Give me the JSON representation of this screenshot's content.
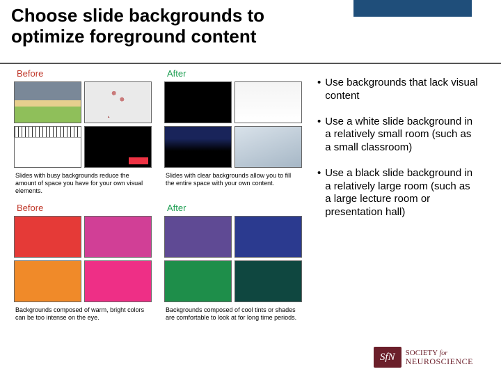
{
  "header": {
    "title": "Choose slide backgrounds to optimize foreground content"
  },
  "labels": {
    "before": "Before",
    "after": "After"
  },
  "captions": {
    "busy": "Slides with busy backgrounds reduce the amount of space you have for your own visual elements.",
    "clear": "Slides with clear backgrounds allow you to fill the entire space with your own content.",
    "warm": "Backgrounds composed of warm, bright colors can be too intense on the eye.",
    "cool": "Backgrounds composed of cool tints or shades are comfortable to look at for long time periods."
  },
  "bullets": {
    "b1": "Use backgrounds that lack visual content",
    "b2": "Use a white slide background in a relatively small room (such as a small classroom)",
    "b3": "Use a black slide background in a relatively large room (such as a large lecture room or presentation hall)"
  },
  "logo": {
    "mark": "SfN",
    "line1_a": "SOCIETY",
    "line1_b": "for",
    "line2": "NEUROSCIENCE"
  }
}
